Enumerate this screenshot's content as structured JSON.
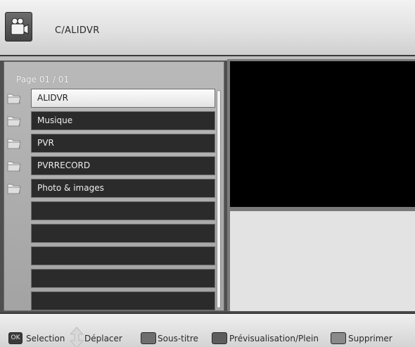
{
  "header": {
    "path": "C/ALIDVR",
    "icon": "media-player-icon"
  },
  "browser": {
    "page_label": "Page  01 / 01",
    "items": [
      {
        "label": "ALIDVR",
        "selected": true,
        "icon": "folder-icon"
      },
      {
        "label": "Musique",
        "selected": false,
        "icon": "folder-icon"
      },
      {
        "label": "PVR",
        "selected": false,
        "icon": "folder-icon"
      },
      {
        "label": "PVRRECORD",
        "selected": false,
        "icon": "folder-icon"
      },
      {
        "label": "Photo & images",
        "selected": false,
        "icon": "folder-icon"
      },
      {
        "label": ""
      },
      {
        "label": ""
      },
      {
        "label": ""
      },
      {
        "label": ""
      },
      {
        "label": ""
      }
    ]
  },
  "footer": {
    "ok_key": "OK",
    "selection": "Selection",
    "move": "Déplacer",
    "subtitle": "Sous-titre",
    "preview": "Prévisualisation/Plein",
    "delete": "Supprimer"
  },
  "colors": {
    "header_bg": "#e2e2e2",
    "panel_bg": "#a9a9a9",
    "row_bg": "#2b2b2b",
    "selected_bg": "#f0f0f0",
    "red_key": "#6e6e6e",
    "green_key": "#5d5d5d",
    "yellow_key": "#8a8a8a",
    "blue_key": "#565656"
  }
}
